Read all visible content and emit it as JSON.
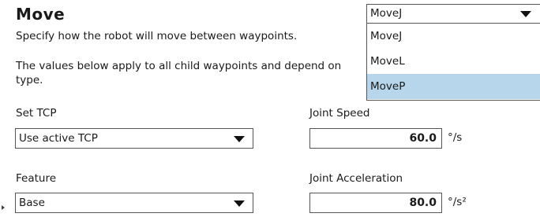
{
  "header": {
    "title": "Move",
    "description": "Specify how the robot will move between waypoints.",
    "note_line1": "The values below apply to all child waypoints and depend on",
    "note_line2": "type."
  },
  "move_type": {
    "selected": "MoveJ",
    "options": [
      "MoveJ",
      "MoveL",
      "MoveP"
    ],
    "highlighted": "MoveP"
  },
  "tcp": {
    "label": "Set TCP",
    "value": "Use active TCP"
  },
  "feature": {
    "label": "Feature",
    "value": "Base"
  },
  "joint_speed": {
    "label": "Joint Speed",
    "value": "60.0",
    "unit": "°/s"
  },
  "joint_acceleration": {
    "label": "Joint Acceleration",
    "value": "80.0",
    "unit": "°/s²"
  },
  "colors": {
    "highlight": "#b7d6ec",
    "border": "#555555",
    "text": "#1a1a1a"
  },
  "icons": {
    "dropdown": "chevron-down-icon",
    "expand": "expand-arrow-icon"
  }
}
